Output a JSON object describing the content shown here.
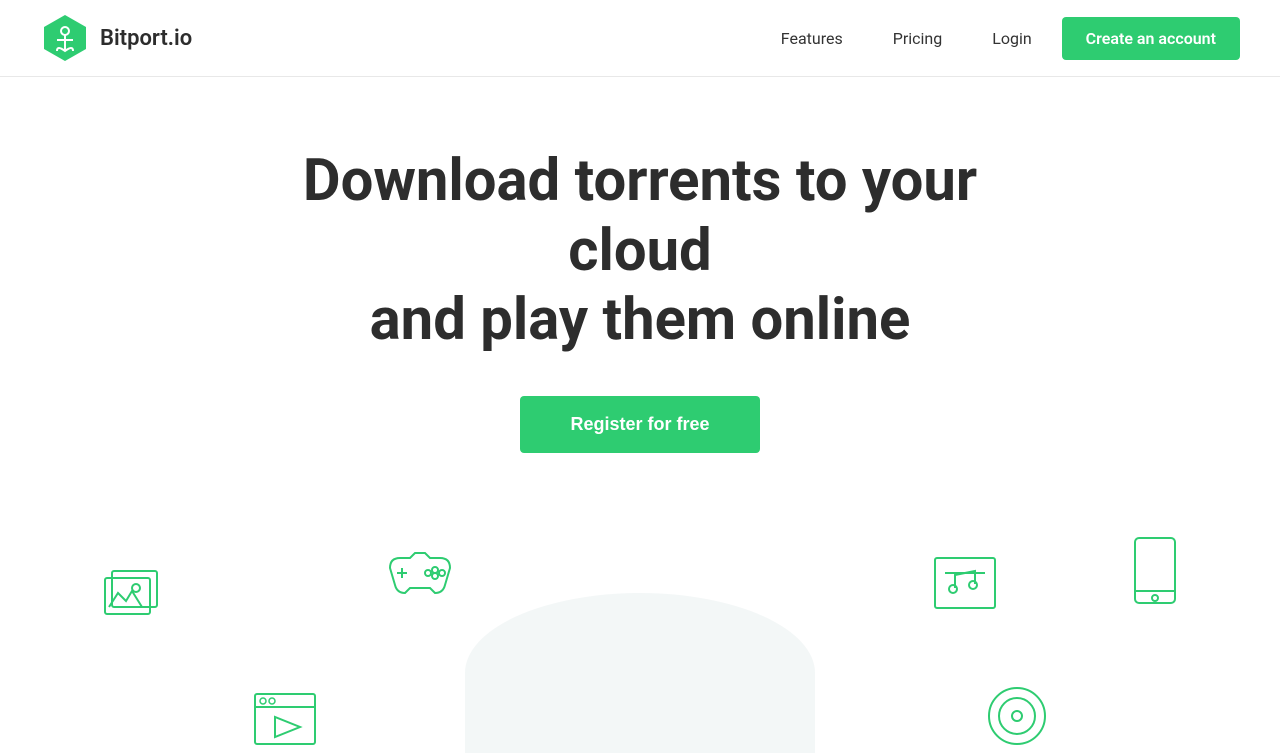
{
  "header": {
    "logo_text": "Bitport.io",
    "nav": {
      "features_label": "Features",
      "pricing_label": "Pricing",
      "login_label": "Login",
      "create_account_label": "Create an account"
    }
  },
  "hero": {
    "title_line1": "Download torrents to your cloud",
    "title_line2": "and play them online",
    "register_label": "Register for free"
  },
  "icons": {
    "photo_icon": "photo-icon",
    "gamepad_icon": "gamepad-icon",
    "music_icon": "music-icon",
    "tablet_icon": "tablet-icon",
    "video_icon": "video-icon",
    "disc_icon": "disc-icon"
  },
  "colors": {
    "green": "#2ecc71",
    "dark": "#2d2d2d",
    "border": "#e8e8e8"
  }
}
